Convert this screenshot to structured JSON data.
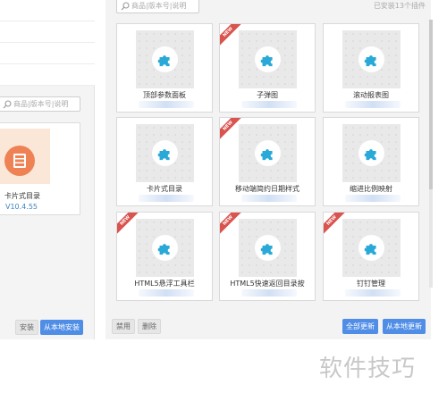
{
  "left_panel": {
    "search_placeholder": "商品|版本号|说明",
    "card": {
      "name": "卡片式目录",
      "version": "V10.4.55"
    },
    "install_label": "安装",
    "install_local_label": "从本地安装"
  },
  "right_panel": {
    "search_placeholder": "商品|版本号|说明",
    "installed_count": "已安装13个插件",
    "plugins": [
      {
        "name": "顶部参数面板",
        "is_new": false
      },
      {
        "name": "子弹图",
        "is_new": true
      },
      {
        "name": "滚动报表图",
        "is_new": false
      },
      {
        "name": "卡片式目录",
        "is_new": false
      },
      {
        "name": "移动端简约日期样式",
        "is_new": true
      },
      {
        "name": "缩进比例映射",
        "is_new": false
      },
      {
        "name": "HTML5悬浮工具栏",
        "is_new": true
      },
      {
        "name": "HTML5快速返回目录按",
        "is_new": true
      },
      {
        "name": "钉钉管理",
        "is_new": true
      }
    ],
    "new_badge": "NEW",
    "disable_label": "禁用",
    "delete_label": "删除",
    "update_all_label": "全部更新",
    "update_local_label": "从本地更新"
  },
  "watermark": "软件技巧",
  "colors": {
    "accent_blue": "#4f8de6",
    "puzzle_blue": "#29a9d8",
    "new_red": "#d9534f",
    "card_orange": "#ee8255"
  },
  "icons": {
    "plugin_icon": "puzzle-icon",
    "search_icon": "search-icon",
    "card_catalog_icon": "card-catalog-icon"
  }
}
